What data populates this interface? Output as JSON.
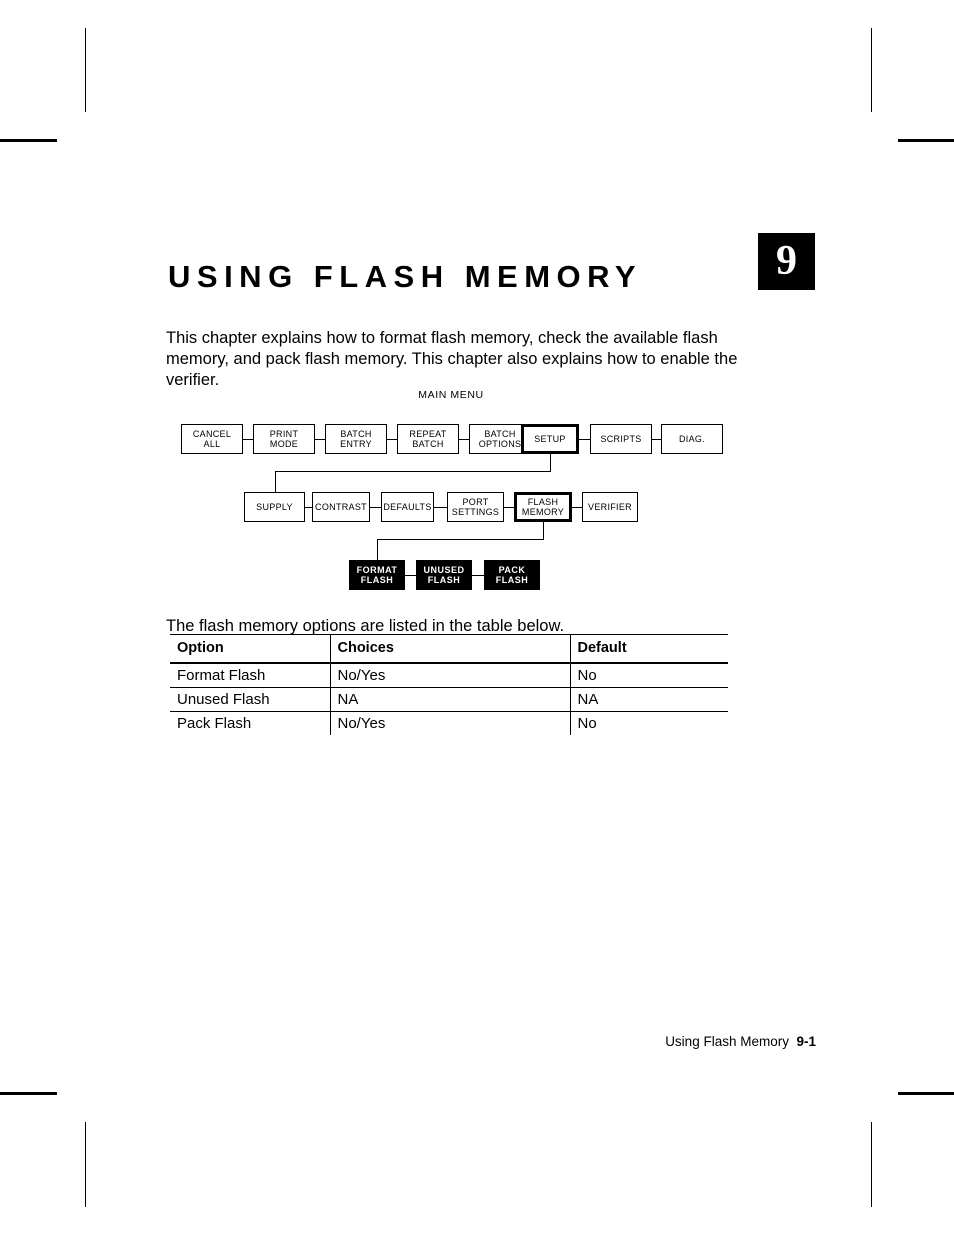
{
  "chapter": {
    "title": "USING FLASH MEMORY",
    "number": "9"
  },
  "intro": "This chapter explains how to format flash memory, check the available flash memory, and pack flash memory.  This chapter also explains how to enable the verifier.",
  "diagram": {
    "label": "MAIN MENU",
    "row1": [
      {
        "line1": "CANCEL",
        "line2": "ALL",
        "style": "normal"
      },
      {
        "line1": "PRINT",
        "line2": "MODE",
        "style": "normal"
      },
      {
        "line1": "BATCH",
        "line2": "ENTRY",
        "style": "normal"
      },
      {
        "line1": "REPEAT",
        "line2": "BATCH",
        "style": "normal"
      },
      {
        "line1": "BATCH",
        "line2": "OPTIONS",
        "style": "normal"
      },
      {
        "line1": "SETUP",
        "line2": "",
        "style": "bold"
      },
      {
        "line1": "SCRIPTS",
        "line2": "",
        "style": "normal"
      },
      {
        "line1": "DIAG.",
        "line2": "",
        "style": "normal"
      }
    ],
    "row2": [
      {
        "line1": "SUPPLY",
        "line2": "",
        "style": "normal"
      },
      {
        "line1": "CONTRAST",
        "line2": "",
        "style": "normal"
      },
      {
        "line1": "DEFAULTS",
        "line2": "",
        "style": "normal"
      },
      {
        "line1": "PORT",
        "line2": "SETTINGS",
        "style": "normal"
      },
      {
        "line1": "FLASH",
        "line2": "MEMORY",
        "style": "bold"
      },
      {
        "line1": "VERIFIER",
        "line2": "",
        "style": "normal"
      }
    ],
    "row3": [
      {
        "line1": "FORMAT",
        "line2": "FLASH",
        "style": "filled"
      },
      {
        "line1": "UNUSED",
        "line2": "FLASH",
        "style": "filled"
      },
      {
        "line1": "PACK",
        "line2": "FLASH",
        "style": "filled"
      }
    ]
  },
  "table_intro": "The flash memory options are listed in the table below.",
  "table": {
    "headers": [
      "Option",
      "Choices",
      "Default"
    ],
    "rows": [
      [
        "Format Flash",
        "No/Yes",
        "No"
      ],
      [
        "Unused Flash",
        "NA",
        "NA"
      ],
      [
        "Pack Flash",
        "No/Yes",
        "No"
      ]
    ]
  },
  "footer": {
    "label": "Using Flash Memory",
    "page": "9-1"
  }
}
